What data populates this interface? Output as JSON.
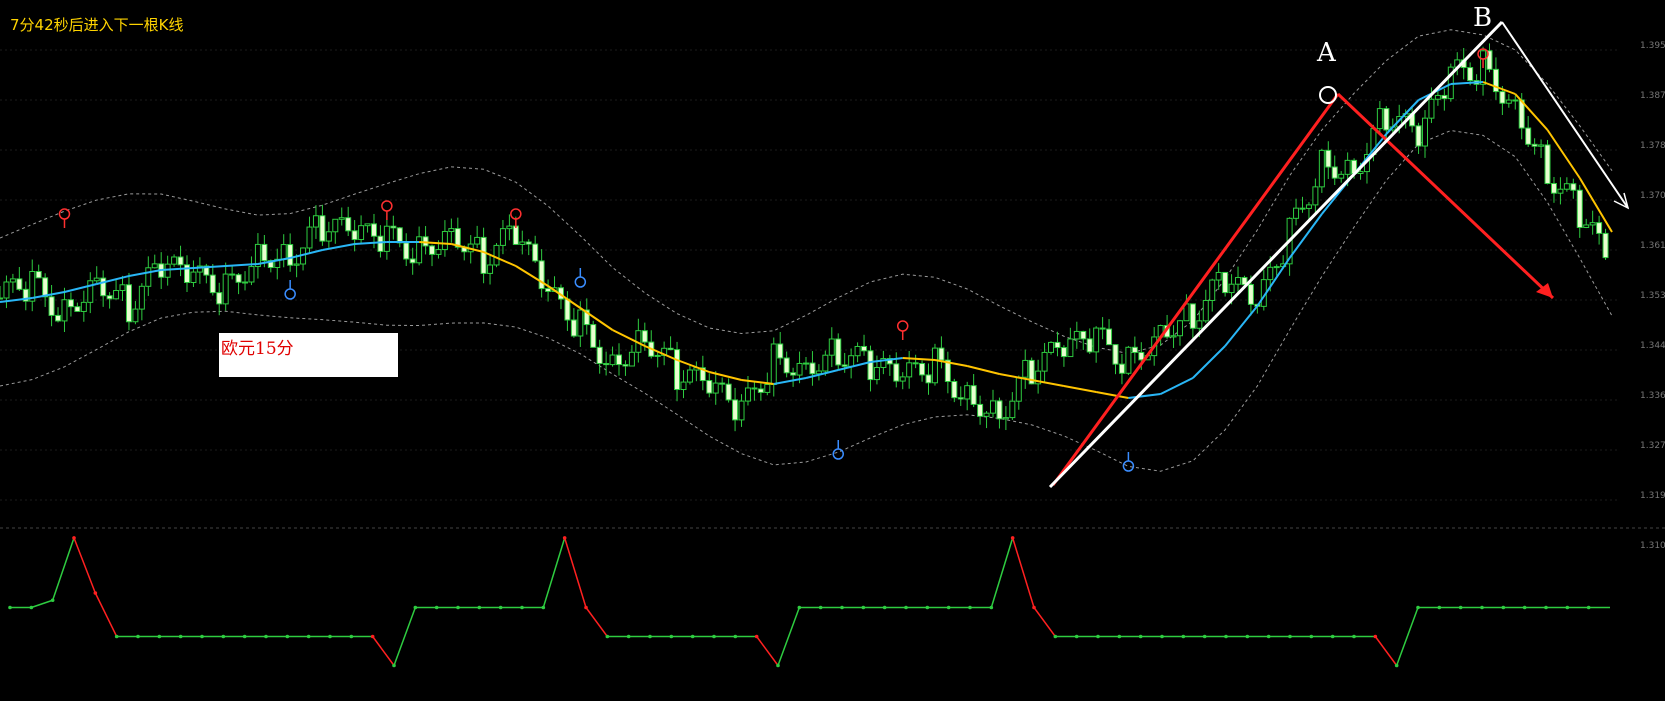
{
  "header": {
    "timer_text": "7分42秒后进入下一根K线"
  },
  "annotation_box": {
    "text": "欧元15分"
  },
  "chart_data": [
    {
      "type": "candlestick",
      "title": "",
      "points": [
        {
          "label": "A",
          "x": 53,
          "y": 1.36
        },
        {
          "label": "B",
          "x": 59,
          "y": 1.39
        }
      ],
      "midline": [
        1.274,
        1.276,
        1.279,
        1.283,
        1.287,
        1.29,
        1.291,
        1.292,
        1.293,
        1.296,
        1.3,
        1.303,
        1.304,
        1.304,
        1.303,
        1.299,
        1.292,
        1.282,
        1.271,
        1.26,
        1.252,
        1.245,
        1.239,
        1.235,
        1.233,
        1.236,
        1.24,
        1.244,
        1.246,
        1.245,
        1.242,
        1.238,
        1.235,
        1.232,
        1.229,
        1.226,
        1.228,
        1.236,
        1.252,
        1.272,
        1.296,
        1.318,
        1.338,
        1.358,
        1.375,
        1.383,
        1.384,
        1.378,
        1.36,
        1.336,
        1.309
      ],
      "close": [
        1.276,
        1.282,
        1.269,
        1.288,
        1.272,
        1.291,
        1.285,
        1.28,
        1.3,
        1.298,
        1.312,
        1.306,
        1.305,
        1.3,
        1.312,
        1.296,
        1.308,
        1.276,
        1.262,
        1.244,
        1.259,
        1.238,
        1.23,
        1.218,
        1.246,
        1.244,
        1.25,
        1.241,
        1.234,
        1.243,
        1.228,
        1.22,
        1.241,
        1.249,
        1.255,
        1.244,
        1.262,
        1.268,
        1.285,
        1.27,
        1.308,
        1.345,
        1.342,
        1.368,
        1.355,
        1.386,
        1.392,
        1.374,
        1.34,
        1.318,
        1.29
      ],
      "band_offset": 0.032,
      "up_markers": [
        {
          "i": 2,
          "y": 1.318
        },
        {
          "i": 12,
          "y": 1.322
        },
        {
          "i": 16,
          "y": 1.318
        },
        {
          "i": 28,
          "y": 1.262
        },
        {
          "i": 46,
          "y": 1.398
        }
      ],
      "down_markers": [
        {
          "i": 9,
          "y": 1.278
        },
        {
          "i": 18,
          "y": 1.284
        },
        {
          "i": 26,
          "y": 1.198
        },
        {
          "i": 35,
          "y": 1.192
        },
        {
          "i": 57,
          "y": 1.262
        }
      ],
      "price_ticks": [
        "1.3955",
        "1.3870",
        "1.3785",
        "1.3700",
        "1.3615",
        "1.3530",
        "1.3445",
        "1.3360",
        "1.3275",
        "1.3190",
        "1.3105"
      ]
    },
    {
      "type": "line",
      "title": "",
      "ylim": [
        0,
        100
      ],
      "values": [
        50,
        50,
        55,
        98,
        60,
        30,
        30,
        30,
        30,
        30,
        30,
        30,
        30,
        30,
        30,
        30,
        30,
        30,
        10,
        50,
        50,
        50,
        50,
        50,
        50,
        50,
        98,
        50,
        30,
        30,
        30,
        30,
        30,
        30,
        30,
        30,
        10,
        50,
        50,
        50,
        50,
        50,
        50,
        50,
        50,
        50,
        50,
        98,
        50,
        30,
        30,
        30,
        30,
        30,
        30,
        30,
        30,
        30,
        30,
        30,
        30,
        30,
        30,
        30,
        30,
        10,
        50,
        50,
        50,
        50,
        50,
        50,
        50,
        50,
        50,
        50
      ]
    }
  ]
}
